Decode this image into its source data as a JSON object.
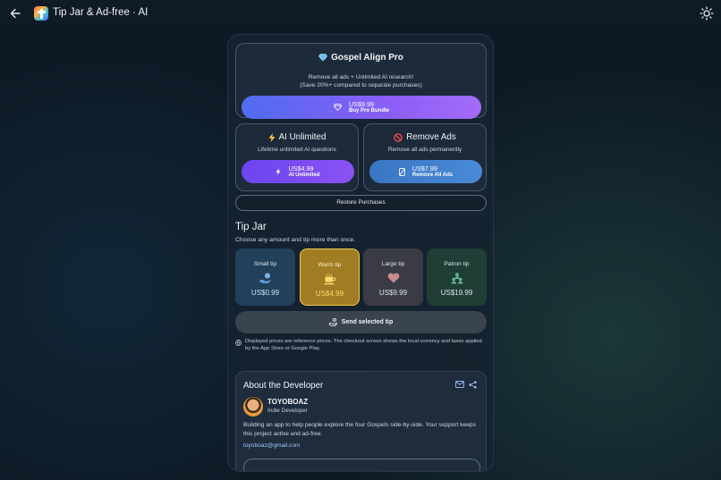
{
  "header": {
    "title": "Tip Jar & Ad-free · AI"
  },
  "pro": {
    "title": "Gospel Align Pro",
    "subtitle1": "Remove all ads + Unlimited AI research!",
    "subtitle2": "(Save 20%+ compared to separate purchases)",
    "price": "US$9.99",
    "button_label": "Buy Pro Bundle"
  },
  "ai_unlimited": {
    "title": "AI Unlimited",
    "subtitle": "Lifetime unlimited AI questions",
    "price": "US$4.99",
    "button_label": "AI Unlimited"
  },
  "remove_ads": {
    "title": "Remove Ads",
    "subtitle": "Remove all ads permanently",
    "price": "US$7.99",
    "button_label": "Remove All Ads"
  },
  "restore": {
    "label": "Restore Purchases"
  },
  "tipjar": {
    "title": "Tip Jar",
    "subtitle": "Choose any amount and tip more than once.",
    "tips": [
      {
        "name": "Small tip",
        "price": "US$0.99",
        "icon": "hand-coin-icon"
      },
      {
        "name": "Warm tip",
        "price": "US$4.99",
        "icon": "coffee-icon",
        "selected": true
      },
      {
        "name": "Large tip",
        "price": "US$9.99",
        "icon": "heart-icon"
      },
      {
        "name": "Patron tip",
        "price": "US$19.99",
        "icon": "people-icon"
      }
    ],
    "send_label": "Send selected tip"
  },
  "notice": "Displayed prices are reference prices. The checkout screen shows the local currency and taxes applied by the App Store or Google Play.",
  "about": {
    "title": "About the Developer",
    "name": "TOYOBOAZ",
    "role": "Indie Developer",
    "description": "Building an app to help people explore the four Gospels side-by-side. Your support keeps this project active and ad-free.",
    "email": "toyoboaz@gmail.com"
  },
  "colors": {
    "background": "#0d1a26",
    "accent_purple": "#8a5df7",
    "accent_blue": "#4a8ad6",
    "selected_tip": "#f2c94c"
  }
}
